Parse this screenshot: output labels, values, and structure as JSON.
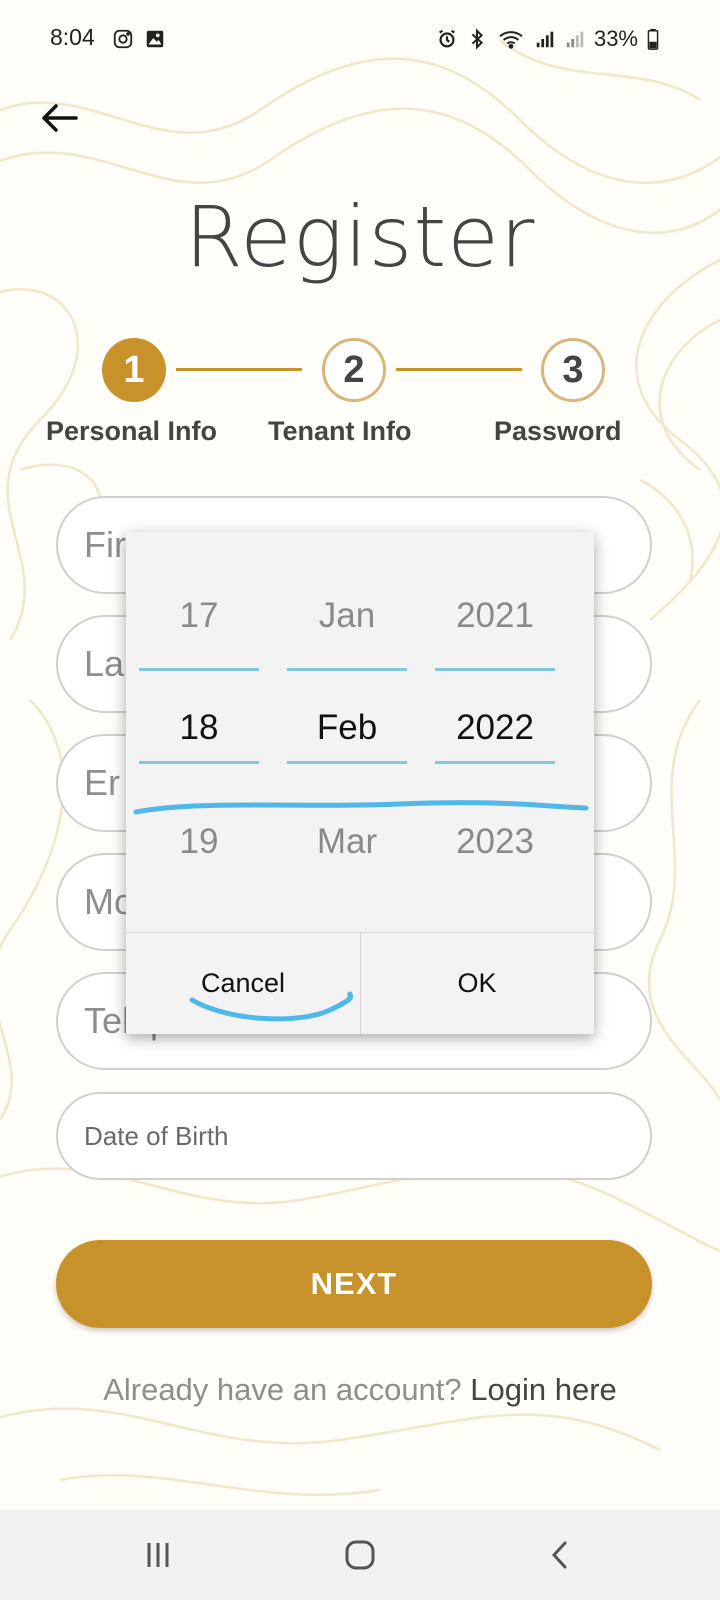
{
  "status_bar": {
    "time": "8:04",
    "battery": "33%",
    "left_icons": [
      "instagram-icon",
      "gallery-icon"
    ],
    "right_icons": [
      "alarm-icon",
      "bluetooth-icon",
      "wifi-icon",
      "signal-icon",
      "signal-icon",
      "battery-icon"
    ]
  },
  "header": {
    "title": "Register"
  },
  "stepper": {
    "steps": [
      {
        "number": "1",
        "label": "Personal Info",
        "state": "active"
      },
      {
        "number": "2",
        "label": "Tenant Info",
        "state": "inactive"
      },
      {
        "number": "3",
        "label": "Password",
        "state": "inactive"
      }
    ]
  },
  "form": {
    "visible_fragments": {
      "first": "Fir",
      "last": "La",
      "email": "Er",
      "mobile": "Mo"
    },
    "telephone_placeholder": "Telephone Number",
    "dob_placeholder": "Date of Birth",
    "next_label": "NEXT"
  },
  "footer": {
    "prompt": "Already have an account? ",
    "link": "Login here"
  },
  "date_picker": {
    "day": {
      "prev": "17",
      "selected": "18",
      "next": "19"
    },
    "month": {
      "prev": "Jan",
      "selected": "Feb",
      "next": "Mar"
    },
    "year": {
      "prev": "2021",
      "selected": "2022",
      "next": "2023"
    },
    "cancel_label": "Cancel",
    "ok_label": "OK"
  },
  "colors": {
    "accent": "#c7922a",
    "annotation": "#4fb8e8",
    "picker_line": "#7fc8e0"
  }
}
